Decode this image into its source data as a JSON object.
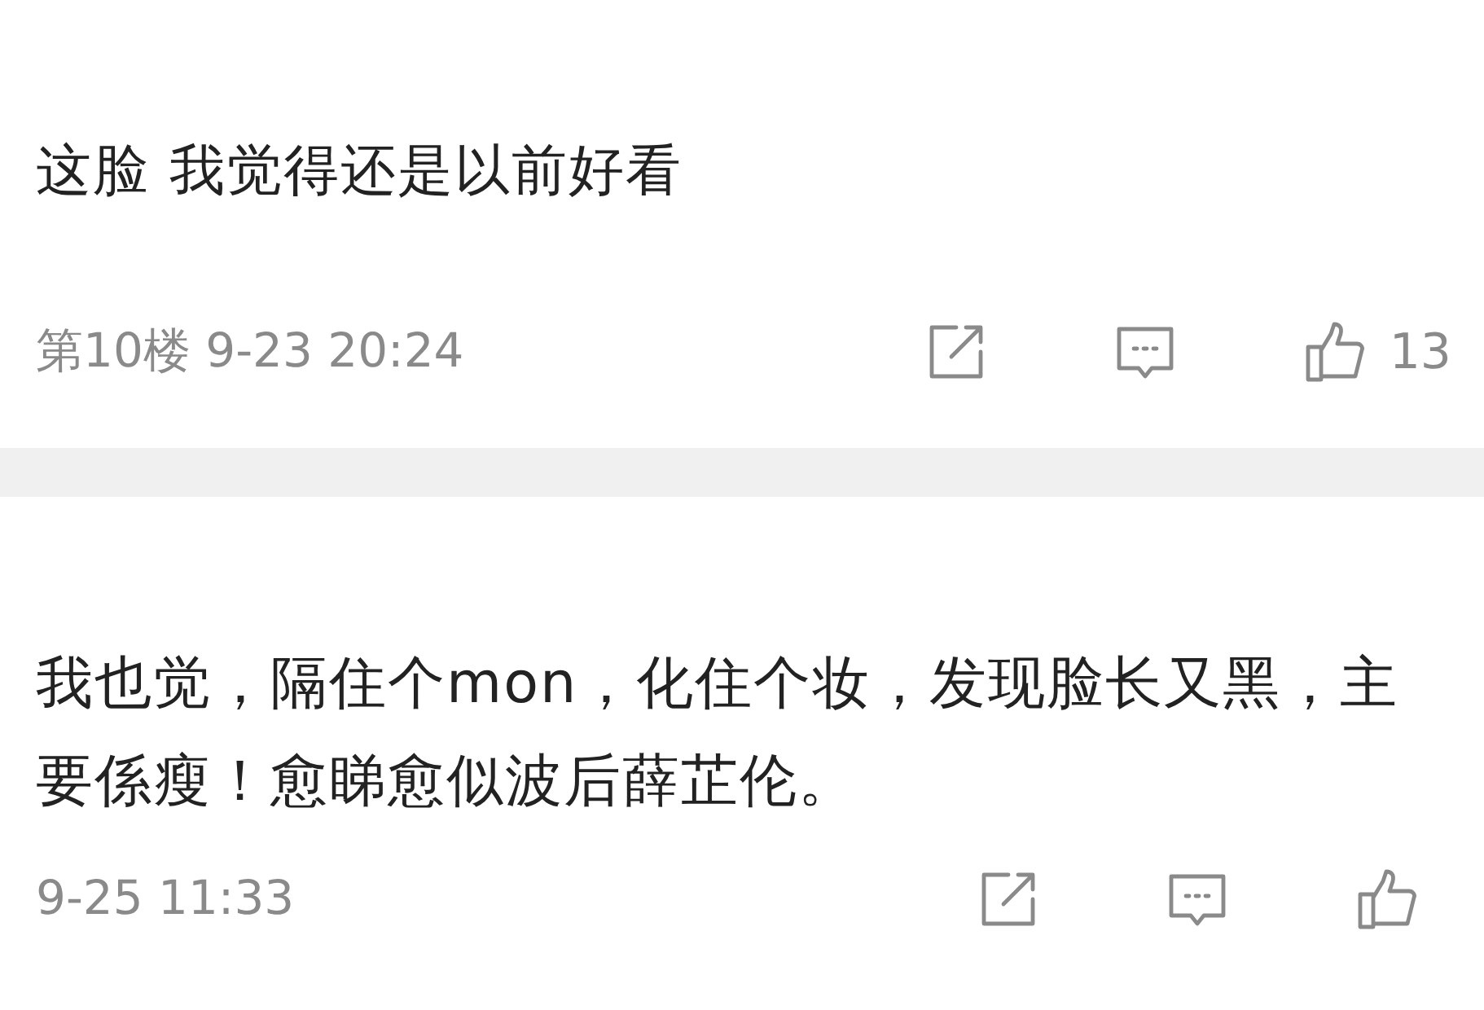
{
  "comments": [
    {
      "text": "这脸  我觉得还是以前好看",
      "floor": "第10楼",
      "time": "9-23 20:24",
      "likes": "13"
    },
    {
      "text": "我也觉，隔住个mon，化住个妆，发现脸长又黑，主要係瘦！愈睇愈似波后薛芷伦。",
      "time": "9-25 11:33"
    }
  ]
}
